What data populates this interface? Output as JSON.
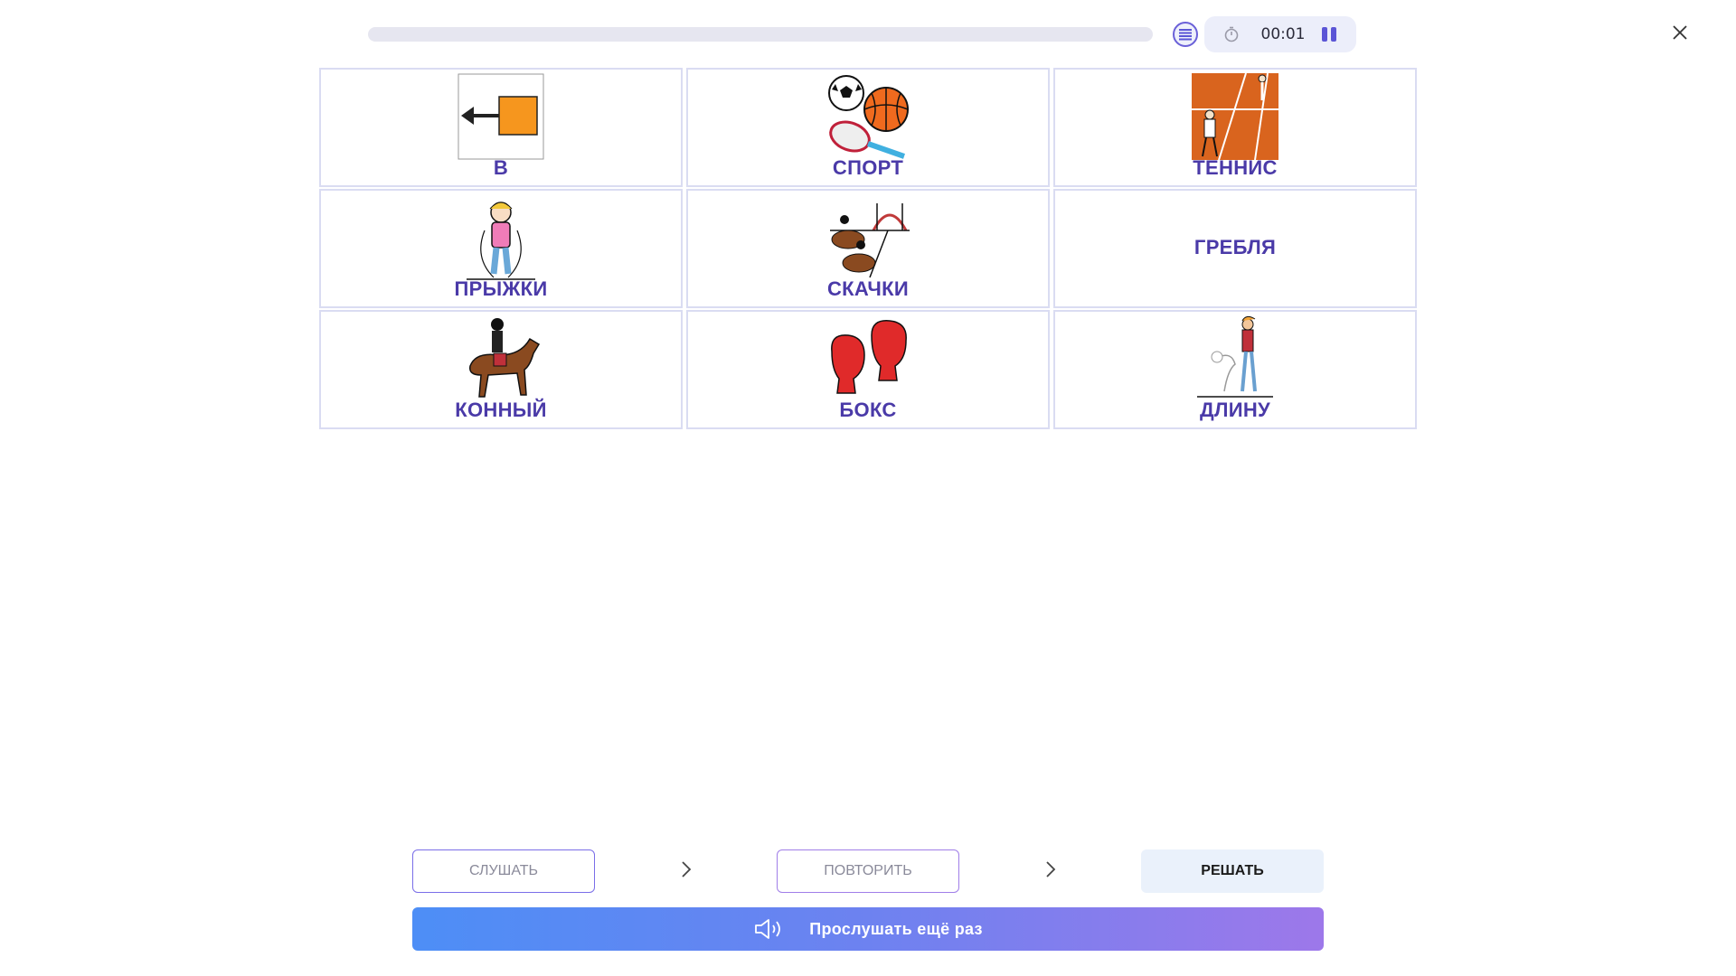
{
  "progress": {
    "fraction": 0.0
  },
  "timer": {
    "time": "00:01"
  },
  "icons": {
    "list": "list-icon",
    "clock": "stopwatch-icon",
    "pause": "pause-icon",
    "close": "close-icon",
    "speaker": "speaker-icon",
    "chevron": "chevron-right-icon"
  },
  "cards": [
    {
      "label": "В",
      "picture": "arrow-into-square"
    },
    {
      "label": "СПОРТ",
      "picture": "balls-and-racket"
    },
    {
      "label": "ТЕННИС",
      "picture": "tennis-court"
    },
    {
      "label": "ПРЫЖКИ",
      "picture": "girl-jumping-rope"
    },
    {
      "label": "СКАЧКИ",
      "picture": "horse-racing"
    },
    {
      "label": "ГРЕБЛЯ",
      "picture": ""
    },
    {
      "label": "КОННЫЙ",
      "picture": "horse-rider"
    },
    {
      "label": "БОКС",
      "picture": "boxing-gloves"
    },
    {
      "label": "ДЛИНУ",
      "picture": "long-jump"
    }
  ],
  "steps": {
    "listen": "СЛУШАТЬ",
    "repeat": "ПОВТОРИТЬ",
    "solve": "РЕШАТЬ"
  },
  "play_again": "Прослушать ещё раз",
  "colors": {
    "accent": "#4a3aa8",
    "gradient_start": "#4d8ef6",
    "gradient_end": "#9d78ea"
  }
}
